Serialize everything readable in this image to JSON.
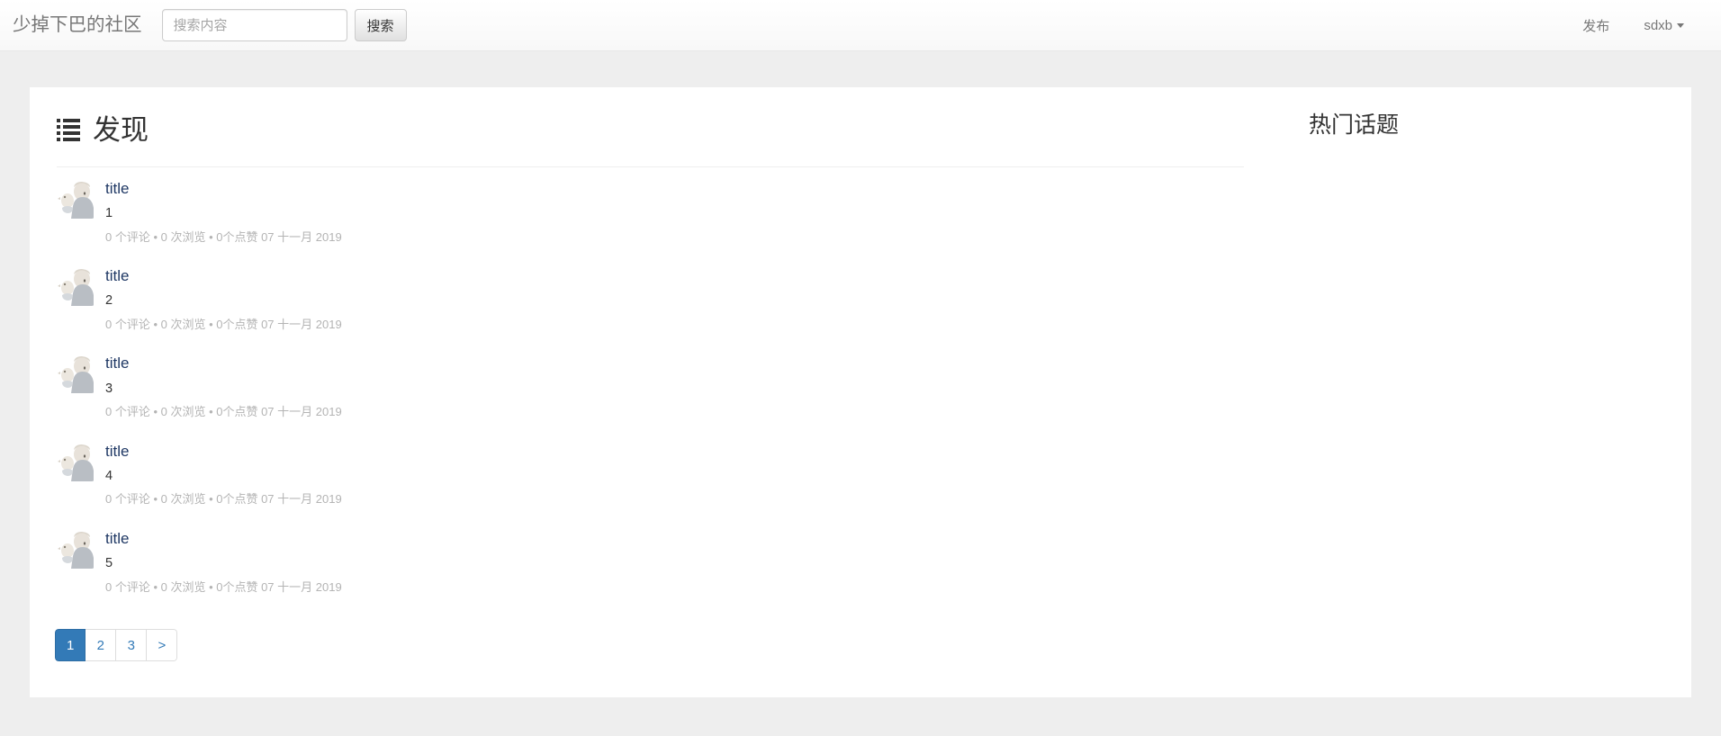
{
  "navbar": {
    "brand": "少掉下巴的社区",
    "search": {
      "placeholder": "搜索内容",
      "value": "",
      "button_label": "搜索"
    },
    "publish_label": "发布",
    "user_label": "sdxb",
    "user_caret_icon": "caret-down-icon"
  },
  "main": {
    "list_icon": "list-icon",
    "title": "发现",
    "posts": [
      {
        "avatar_icon": "user-avatar-image",
        "title": "title",
        "text": "1",
        "meta": "0 个评论 • 0 次浏览 • 0个点赞 07 十一月 2019"
      },
      {
        "avatar_icon": "user-avatar-image",
        "title": "title",
        "text": "2",
        "meta": "0 个评论 • 0 次浏览 • 0个点赞 07 十一月 2019"
      },
      {
        "avatar_icon": "user-avatar-image",
        "title": "title",
        "text": "3",
        "meta": "0 个评论 • 0 次浏览 • 0个点赞 07 十一月 2019"
      },
      {
        "avatar_icon": "user-avatar-image",
        "title": "title",
        "text": "4",
        "meta": "0 个评论 • 0 次浏览 • 0个点赞 07 十一月 2019"
      },
      {
        "avatar_icon": "user-avatar-image",
        "title": "title",
        "text": "5",
        "meta": "0 个评论 • 0 次浏览 • 0个点赞 07 十一月 2019"
      }
    ],
    "pagination": {
      "pages": [
        "1",
        "2",
        "3",
        ">"
      ],
      "current": "1"
    }
  },
  "sidebar": {
    "title": "热门话题",
    "items": []
  },
  "colors": {
    "page_background": "#eeeeee",
    "navbar_background": "#f8f8f8",
    "panel_background": "#ffffff",
    "accent": "#337ab7",
    "link": "#1f3864",
    "muted_text": "#b4b4b4",
    "brand_text": "#777777"
  }
}
